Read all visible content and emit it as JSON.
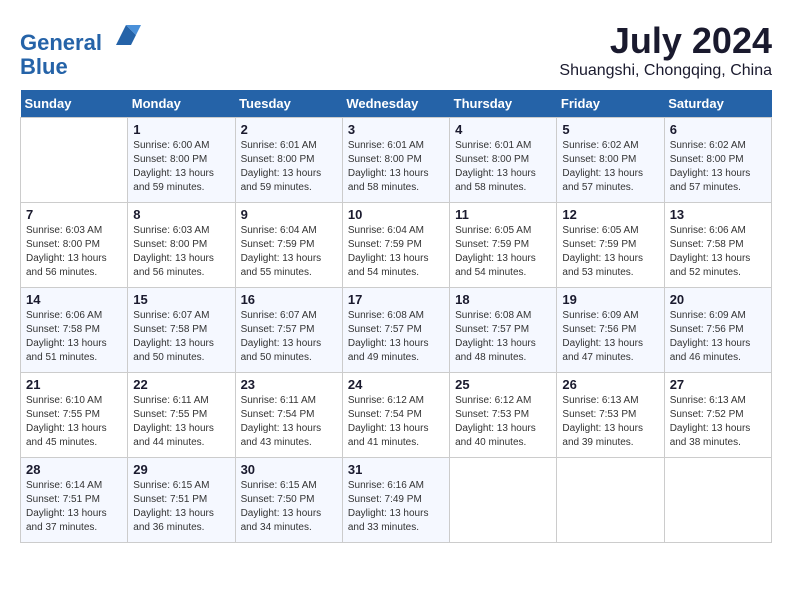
{
  "header": {
    "logo_line1": "General",
    "logo_line2": "Blue",
    "month_year": "July 2024",
    "location": "Shuangshi, Chongqing, China"
  },
  "days_of_week": [
    "Sunday",
    "Monday",
    "Tuesday",
    "Wednesday",
    "Thursday",
    "Friday",
    "Saturday"
  ],
  "weeks": [
    [
      {
        "day": "",
        "info": ""
      },
      {
        "day": "1",
        "info": "Sunrise: 6:00 AM\nSunset: 8:00 PM\nDaylight: 13 hours\nand 59 minutes."
      },
      {
        "day": "2",
        "info": "Sunrise: 6:01 AM\nSunset: 8:00 PM\nDaylight: 13 hours\nand 59 minutes."
      },
      {
        "day": "3",
        "info": "Sunrise: 6:01 AM\nSunset: 8:00 PM\nDaylight: 13 hours\nand 58 minutes."
      },
      {
        "day": "4",
        "info": "Sunrise: 6:01 AM\nSunset: 8:00 PM\nDaylight: 13 hours\nand 58 minutes."
      },
      {
        "day": "5",
        "info": "Sunrise: 6:02 AM\nSunset: 8:00 PM\nDaylight: 13 hours\nand 57 minutes."
      },
      {
        "day": "6",
        "info": "Sunrise: 6:02 AM\nSunset: 8:00 PM\nDaylight: 13 hours\nand 57 minutes."
      }
    ],
    [
      {
        "day": "7",
        "info": "Sunrise: 6:03 AM\nSunset: 8:00 PM\nDaylight: 13 hours\nand 56 minutes."
      },
      {
        "day": "8",
        "info": "Sunrise: 6:03 AM\nSunset: 8:00 PM\nDaylight: 13 hours\nand 56 minutes."
      },
      {
        "day": "9",
        "info": "Sunrise: 6:04 AM\nSunset: 7:59 PM\nDaylight: 13 hours\nand 55 minutes."
      },
      {
        "day": "10",
        "info": "Sunrise: 6:04 AM\nSunset: 7:59 PM\nDaylight: 13 hours\nand 54 minutes."
      },
      {
        "day": "11",
        "info": "Sunrise: 6:05 AM\nSunset: 7:59 PM\nDaylight: 13 hours\nand 54 minutes."
      },
      {
        "day": "12",
        "info": "Sunrise: 6:05 AM\nSunset: 7:59 PM\nDaylight: 13 hours\nand 53 minutes."
      },
      {
        "day": "13",
        "info": "Sunrise: 6:06 AM\nSunset: 7:58 PM\nDaylight: 13 hours\nand 52 minutes."
      }
    ],
    [
      {
        "day": "14",
        "info": "Sunrise: 6:06 AM\nSunset: 7:58 PM\nDaylight: 13 hours\nand 51 minutes."
      },
      {
        "day": "15",
        "info": "Sunrise: 6:07 AM\nSunset: 7:58 PM\nDaylight: 13 hours\nand 50 minutes."
      },
      {
        "day": "16",
        "info": "Sunrise: 6:07 AM\nSunset: 7:57 PM\nDaylight: 13 hours\nand 50 minutes."
      },
      {
        "day": "17",
        "info": "Sunrise: 6:08 AM\nSunset: 7:57 PM\nDaylight: 13 hours\nand 49 minutes."
      },
      {
        "day": "18",
        "info": "Sunrise: 6:08 AM\nSunset: 7:57 PM\nDaylight: 13 hours\nand 48 minutes."
      },
      {
        "day": "19",
        "info": "Sunrise: 6:09 AM\nSunset: 7:56 PM\nDaylight: 13 hours\nand 47 minutes."
      },
      {
        "day": "20",
        "info": "Sunrise: 6:09 AM\nSunset: 7:56 PM\nDaylight: 13 hours\nand 46 minutes."
      }
    ],
    [
      {
        "day": "21",
        "info": "Sunrise: 6:10 AM\nSunset: 7:55 PM\nDaylight: 13 hours\nand 45 minutes."
      },
      {
        "day": "22",
        "info": "Sunrise: 6:11 AM\nSunset: 7:55 PM\nDaylight: 13 hours\nand 44 minutes."
      },
      {
        "day": "23",
        "info": "Sunrise: 6:11 AM\nSunset: 7:54 PM\nDaylight: 13 hours\nand 43 minutes."
      },
      {
        "day": "24",
        "info": "Sunrise: 6:12 AM\nSunset: 7:54 PM\nDaylight: 13 hours\nand 41 minutes."
      },
      {
        "day": "25",
        "info": "Sunrise: 6:12 AM\nSunset: 7:53 PM\nDaylight: 13 hours\nand 40 minutes."
      },
      {
        "day": "26",
        "info": "Sunrise: 6:13 AM\nSunset: 7:53 PM\nDaylight: 13 hours\nand 39 minutes."
      },
      {
        "day": "27",
        "info": "Sunrise: 6:13 AM\nSunset: 7:52 PM\nDaylight: 13 hours\nand 38 minutes."
      }
    ],
    [
      {
        "day": "28",
        "info": "Sunrise: 6:14 AM\nSunset: 7:51 PM\nDaylight: 13 hours\nand 37 minutes."
      },
      {
        "day": "29",
        "info": "Sunrise: 6:15 AM\nSunset: 7:51 PM\nDaylight: 13 hours\nand 36 minutes."
      },
      {
        "day": "30",
        "info": "Sunrise: 6:15 AM\nSunset: 7:50 PM\nDaylight: 13 hours\nand 34 minutes."
      },
      {
        "day": "31",
        "info": "Sunrise: 6:16 AM\nSunset: 7:49 PM\nDaylight: 13 hours\nand 33 minutes."
      },
      {
        "day": "",
        "info": ""
      },
      {
        "day": "",
        "info": ""
      },
      {
        "day": "",
        "info": ""
      }
    ]
  ]
}
